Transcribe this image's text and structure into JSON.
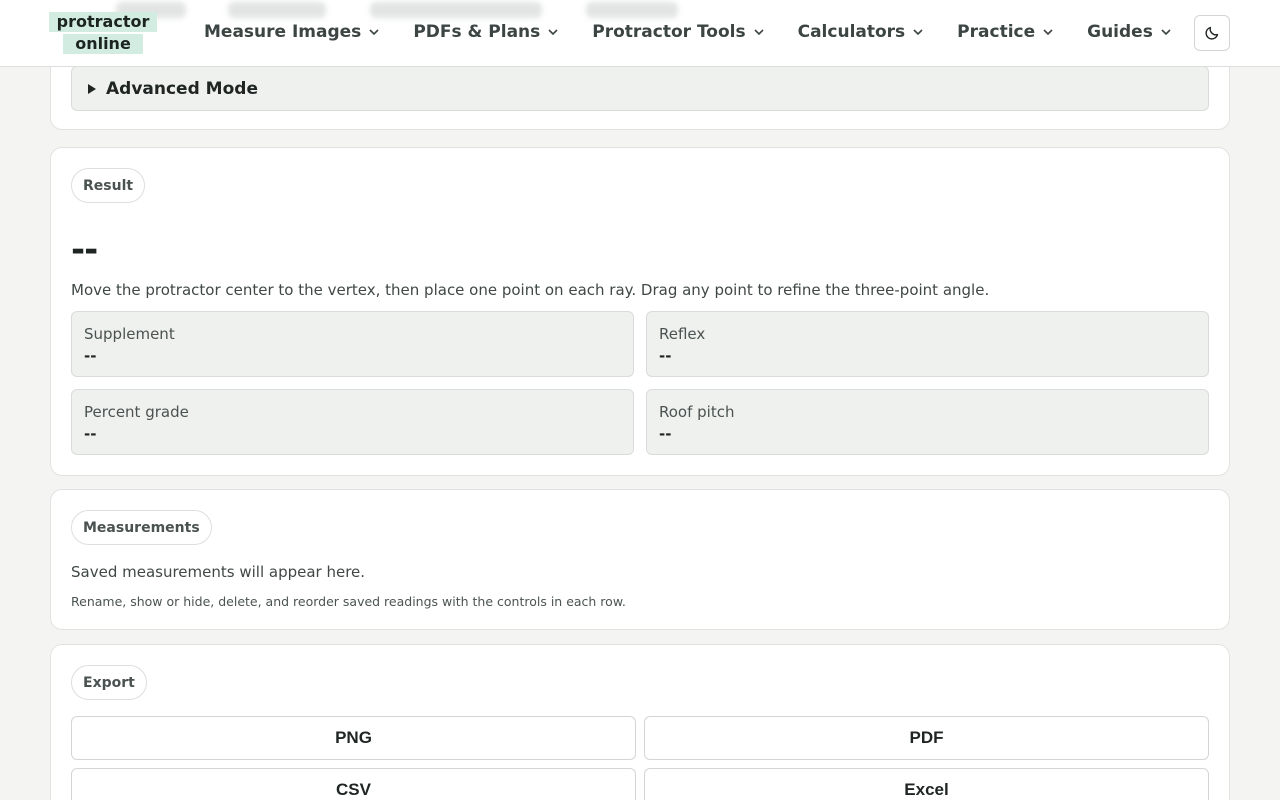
{
  "brand": {
    "line1": "protractor",
    "line2": "online",
    "accent": "#d3ece2"
  },
  "nav": [
    {
      "label": "Measure Images"
    },
    {
      "label": "PDFs & Plans"
    },
    {
      "label": "Protractor Tools"
    },
    {
      "label": "Calculators"
    },
    {
      "label": "Practice"
    },
    {
      "label": "Guides"
    }
  ],
  "theme_toggle": {
    "icon": "moon-icon"
  },
  "advanced": {
    "label": "Advanced Mode"
  },
  "result": {
    "badge": "Result",
    "value": "--",
    "instructions": "Move the protractor center to the vertex, then place one point on each ray. Drag any point to refine the three-point angle.",
    "stats": [
      {
        "label": "Supplement",
        "value": "--"
      },
      {
        "label": "Reflex",
        "value": "--"
      },
      {
        "label": "Percent grade",
        "value": "--"
      },
      {
        "label": "Roof pitch",
        "value": "--"
      }
    ]
  },
  "measurements": {
    "badge": "Measurements",
    "empty": "Saved measurements will appear here.",
    "hint": "Rename, show or hide, delete, and reorder saved readings with the controls in each row."
  },
  "export": {
    "badge": "Export",
    "buttons": [
      {
        "label": "PNG"
      },
      {
        "label": "PDF"
      },
      {
        "label": "CSV"
      },
      {
        "label": "Excel"
      }
    ]
  }
}
